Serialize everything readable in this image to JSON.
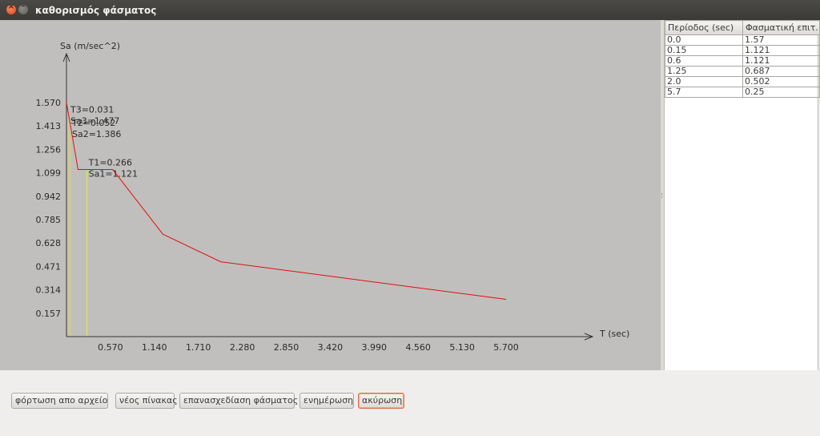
{
  "window": {
    "title": "καθορισμός φάσματος"
  },
  "chart_data": {
    "type": "line",
    "ylabel": "Sa (m/sec^2)",
    "xlabel": "T (sec)",
    "x_ticks": [
      "0.570",
      "1.140",
      "1.710",
      "2.280",
      "2.850",
      "3.420",
      "3.990",
      "4.560",
      "5.130",
      "5.700"
    ],
    "y_ticks": [
      "0.157",
      "0.314",
      "0.471",
      "0.628",
      "0.785",
      "0.942",
      "1.099",
      "1.256",
      "1.413",
      "1.570"
    ],
    "xlim": [
      0,
      5.7
    ],
    "ylim": [
      0,
      1.57
    ],
    "series": [
      {
        "x": [
          0.0,
          0.15,
          0.6,
          1.25,
          2.0,
          5.7
        ],
        "y": [
          1.57,
          1.121,
          1.121,
          0.687,
          0.502,
          0.25
        ],
        "color": "#e01010"
      }
    ],
    "annotations": [
      {
        "period": 0.031,
        "sa": 1.477,
        "t_text": "T3=0.031",
        "sa_text": "Sa3=1.477",
        "color": "#d6d07a"
      },
      {
        "period": 0.052,
        "sa": 1.386,
        "t_text": "T2=0.052",
        "sa_text": "Sa2=1.386",
        "color": "#d6d07a"
      },
      {
        "period": 0.266,
        "sa": 1.121,
        "t_text": "T1=0.266",
        "sa_text": "Sa1=1.121",
        "color": "#eaea40"
      }
    ]
  },
  "table": {
    "headers": [
      "Περίοδος (sec)",
      "Φασματική επιτ..."
    ],
    "rows": [
      [
        "0.0",
        "1.57"
      ],
      [
        "0.15",
        "1.121"
      ],
      [
        "0.6",
        "1.121"
      ],
      [
        "1.25",
        "0.687"
      ],
      [
        "2.0",
        "0.502"
      ],
      [
        "5.7",
        "0.25"
      ]
    ]
  },
  "buttons": {
    "load_file": "φόρτωση απο αρχείο",
    "new_table": "νέος πίνακας",
    "redraw": "επανασχεδίαση φάσματος",
    "update": "ενημέρωση",
    "cancel": "ακύρωση"
  },
  "colors": {
    "chart_bg": "#c0bfbd",
    "accent": "#e0704a"
  }
}
